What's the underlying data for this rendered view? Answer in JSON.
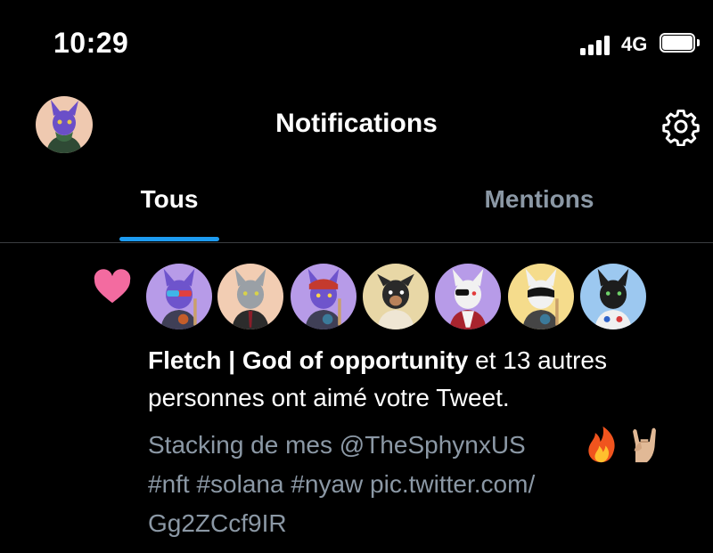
{
  "status_bar": {
    "time": "10:29",
    "network": "4G"
  },
  "header": {
    "title": "Notifications",
    "settings_icon": "gear-icon",
    "profile_icon": "avatar"
  },
  "tabs": [
    {
      "label": "Tous",
      "active": true
    },
    {
      "label": "Mentions",
      "active": false
    }
  ],
  "notification": {
    "type_icon": "heart-icon",
    "liker_count": 7,
    "actor_name": "Fletch | God of opportunity",
    "action_text": " et 13 autres personnes ont aimé votre Tweet.",
    "tweet_text": "Stacking de mes @TheSphynxUS #nft #solana #nyaw pic.twitter.com/ Gg2ZCcf9IR",
    "tweet_line1": "Stacking de mes @TheSphynxUS",
    "tweet_line2": "#nft #solana #nyaw pic.twitter.com/",
    "tweet_line3": "Gg2ZCcf9IR",
    "emojis": [
      "fire-emoji",
      "rock-hand-emoji"
    ]
  },
  "colors": {
    "background": "#000000",
    "accent": "#1d9bf0",
    "heart": "#f36ba0",
    "muted_text": "#8b98a5",
    "divider": "#3a3d40"
  }
}
